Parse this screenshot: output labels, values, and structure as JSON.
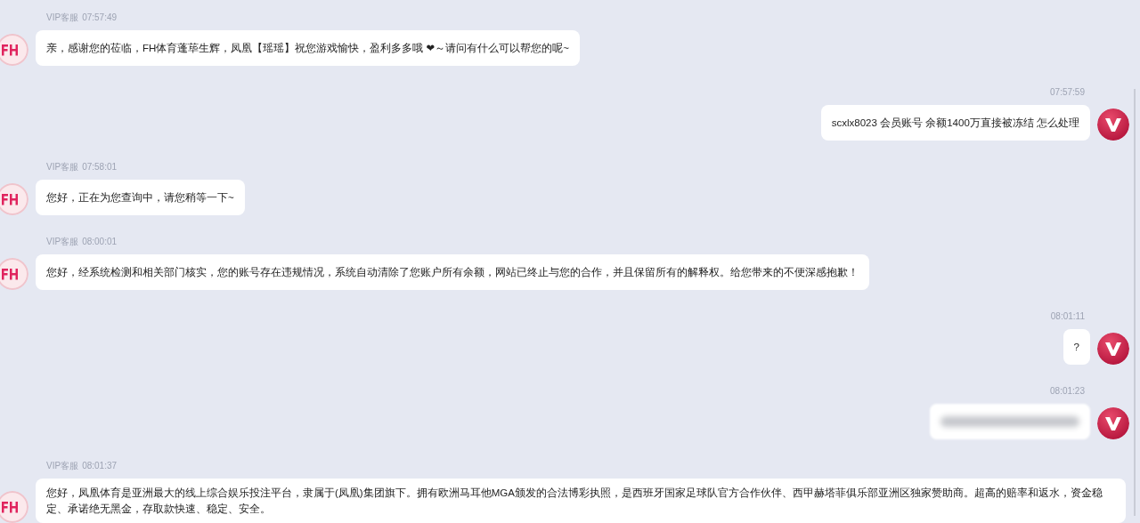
{
  "messages": [
    {
      "kind": "agent",
      "sender": "VIP客服",
      "time": "07:57:49",
      "text": "亲，感谢您的莅临，FH体育蓬荜生辉，凤凰【瑶瑶】祝您游戏愉快，盈利多多哦 ❤～请问有什么可以帮您的呢~",
      "blurred": false
    },
    {
      "kind": "user",
      "time": "07:57:59",
      "text": "scxlx8023 会员账号 余额1400万直接被冻结 怎么处理",
      "blurred": false
    },
    {
      "kind": "agent",
      "sender": "VIP客服",
      "time": "07:58:01",
      "text": "您好，正在为您查询中，请您稍等一下~",
      "blurred": false
    },
    {
      "kind": "agent",
      "sender": "VIP客服",
      "time": "08:00:01",
      "text": "您好，经系统检测和相关部门核实，您的账号存在违规情况，系统自动清除了您账户所有余额，网站已终止与您的合作，并且保留所有的解释权。给您带来的不便深感抱歉！",
      "blurred": false
    },
    {
      "kind": "user",
      "time": "08:01:11",
      "text": "?",
      "blurred": false
    },
    {
      "kind": "user",
      "time": "08:01:23",
      "blurred": true
    },
    {
      "kind": "agent",
      "sender": "VIP客服",
      "time": "08:01:37",
      "text": "您好，凤凰体育是亚洲最大的线上综合娱乐投注平台，隶属于(凤凰)集团旗下。拥有欧洲马耳他MGA颁发的合法博彩执照，是西班牙国家足球队官方合作伙伴、西甲赫塔菲俱乐部亚洲区独家赞助商。超高的赔率和返水，资金稳定、承诺绝无黑金，存取款快速、稳定、安全。",
      "blurred": false
    }
  ]
}
